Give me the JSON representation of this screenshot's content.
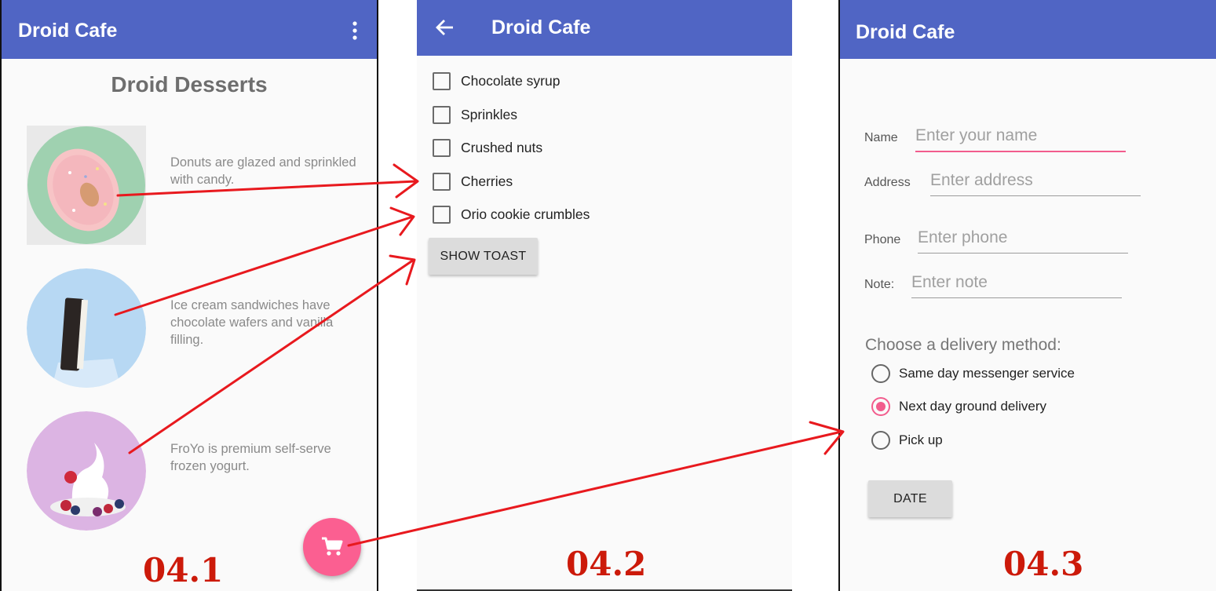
{
  "screens": [
    {
      "appbar": {
        "title": "Droid Cafe",
        "menu_icon": "overflow-menu-icon"
      },
      "heading": "Droid Desserts",
      "items": [
        {
          "image": "donut-image",
          "description": "Donuts are glazed and sprinkled with candy."
        },
        {
          "image": "ice-cream-sandwich-image",
          "description": "Ice cream sandwiches have chocolate wafers and vanilla filling."
        },
        {
          "image": "froyo-image",
          "description": "FroYo is premium self-serve frozen yogurt."
        }
      ],
      "fab": {
        "icon": "shopping-cart-icon"
      },
      "caption": "04.1"
    },
    {
      "appbar": {
        "title": "Droid Cafe",
        "back_icon": "back-arrow-icon"
      },
      "toppings": [
        "Chocolate syrup",
        "Sprinkles",
        "Crushed nuts",
        "Cherries",
        "Orio cookie crumbles"
      ],
      "button": "SHOW TOAST",
      "caption": "04.2"
    },
    {
      "appbar": {
        "title": "Droid Cafe"
      },
      "fields": [
        {
          "label": "Name",
          "placeholder": "Enter your name"
        },
        {
          "label": "Address",
          "placeholder": "Enter address"
        },
        {
          "label": "Phone",
          "placeholder": "Enter phone"
        },
        {
          "label": "Note:",
          "placeholder": "Enter note"
        }
      ],
      "delivery_prompt": "Choose a delivery method:",
      "delivery_options": [
        {
          "label": "Same day messenger service",
          "selected": false
        },
        {
          "label": "Next day ground delivery",
          "selected": true
        },
        {
          "label": "Pick up",
          "selected": false
        }
      ],
      "button": "DATE",
      "caption": "04.3"
    }
  ],
  "colors": {
    "appbar": "#5065c4",
    "accent": "#fb5f91",
    "annotation": "#e8191e",
    "caption": "#cc1a0a"
  }
}
